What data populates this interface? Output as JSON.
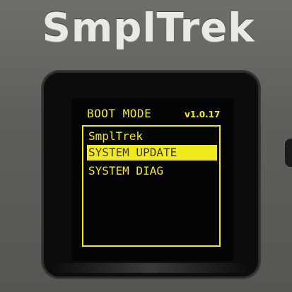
{
  "device": {
    "brand": "SmplTrek"
  },
  "screen": {
    "header": {
      "title": "BOOT MODE",
      "version": "v1.0.17"
    },
    "menu": {
      "items": [
        {
          "label": "SmplTrek",
          "selected": false
        },
        {
          "label": "SYSTEM UPDATE",
          "selected": true
        },
        {
          "label": "SYSTEM DIAG",
          "selected": false
        }
      ]
    }
  },
  "colors": {
    "lcd_text": "#f1eb1d",
    "lcd_background": "#050505",
    "selected_text": "#3a3a18",
    "bezel": "#0c0c0c",
    "body": "#5e5f5c"
  }
}
